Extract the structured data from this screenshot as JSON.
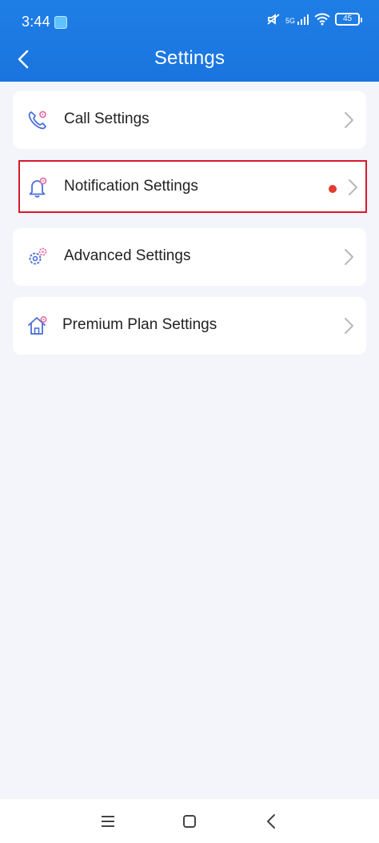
{
  "status_bar": {
    "time": "3:44",
    "network": "5G",
    "battery": "45"
  },
  "header": {
    "title": "Settings",
    "back_icon": "chevron-left-icon"
  },
  "settings": {
    "items": [
      {
        "label": "Call Settings",
        "icon": "phone-gear-icon"
      },
      {
        "label": "Notification Settings",
        "icon": "bell-gear-icon",
        "badge": true,
        "highlighted": true
      },
      {
        "label": "Advanced Settings",
        "icon": "gears-icon"
      },
      {
        "label": "Premium Plan Settings",
        "icon": "house-gear-icon"
      }
    ]
  },
  "colors": {
    "header": "#1a74df",
    "background": "#f3f5fa",
    "card": "#ffffff",
    "highlight_border": "#d61a2c",
    "badge": "#e23b2e",
    "icon_blue": "#4a6fd8",
    "icon_pink": "#e36ea8"
  },
  "nav_bar": {
    "items": [
      "menu-icon",
      "home-icon",
      "back-icon"
    ]
  }
}
